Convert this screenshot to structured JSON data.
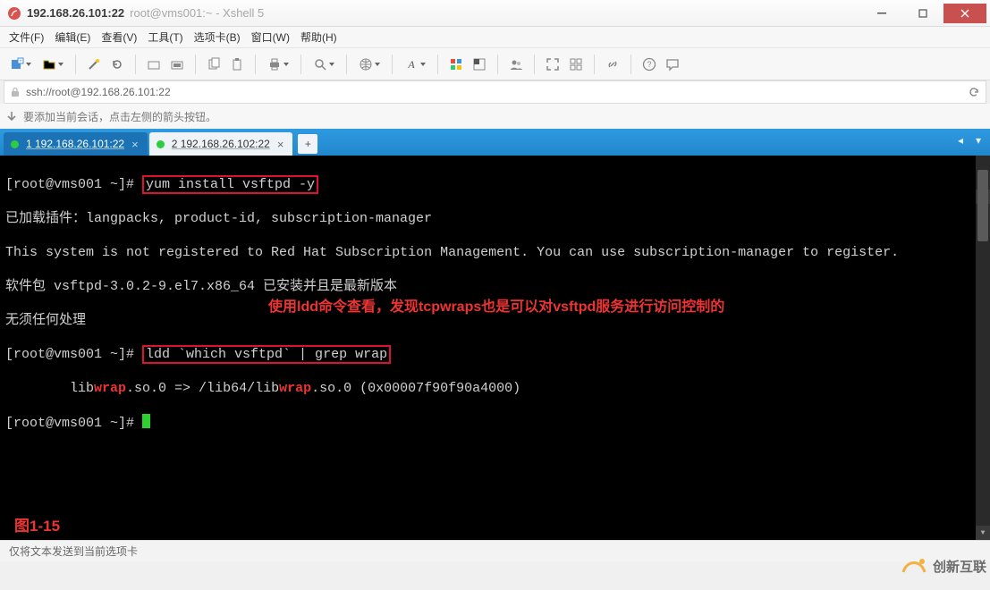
{
  "window": {
    "host_strong": "192.168.26.101:22",
    "title_suffix": "root@vms001:~ - Xshell 5",
    "min_icon": "minimize-icon",
    "max_icon": "maximize-icon",
    "close_icon": "close-icon"
  },
  "menu": {
    "items": [
      "文件(F)",
      "编辑(E)",
      "查看(V)",
      "工具(T)",
      "选项卡(B)",
      "窗口(W)",
      "帮助(H)"
    ]
  },
  "toolbar": {
    "items": [
      {
        "name": "new-session-icon",
        "dd": true
      },
      {
        "name": "open-icon",
        "dd": true
      },
      {
        "sep": true
      },
      {
        "name": "wand-icon"
      },
      {
        "name": "reconnect-icon"
      },
      {
        "sep": true
      },
      {
        "name": "folder-small-icon"
      },
      {
        "name": "folder-open-icon"
      },
      {
        "sep": true
      },
      {
        "name": "copy-icon"
      },
      {
        "name": "paste-icon"
      },
      {
        "sep": true
      },
      {
        "name": "print-icon",
        "dd": true
      },
      {
        "sep": true
      },
      {
        "name": "search-icon",
        "dd": true
      },
      {
        "sep": true
      },
      {
        "name": "globe-icon",
        "dd": true
      },
      {
        "sep": true
      },
      {
        "name": "font-icon",
        "dd": true
      },
      {
        "sep": true
      },
      {
        "name": "palette-icon"
      },
      {
        "name": "palette2-icon"
      },
      {
        "sep": true
      },
      {
        "name": "people-icon"
      },
      {
        "sep": true
      },
      {
        "name": "fullscreen-icon"
      },
      {
        "name": "tile-icon"
      },
      {
        "sep": true
      },
      {
        "name": "link-icon"
      },
      {
        "sep": true
      },
      {
        "name": "help-icon"
      },
      {
        "name": "chat-icon"
      }
    ]
  },
  "address": {
    "lock_icon": "lock-icon",
    "url": "ssh://root@192.168.26.101:22",
    "refresh_icon": "refresh-icon"
  },
  "hint": {
    "arrow_icon": "arrow-down-icon",
    "text": "要添加当前会话，点击左侧的箭头按钮。"
  },
  "tabs": {
    "items": [
      {
        "label": "1 192.168.26.101:22",
        "active": true
      },
      {
        "label": "2 192.168.26.102:22",
        "active": false
      }
    ],
    "add_label": "+",
    "prev_icon": "chevron-left-icon",
    "next_icon": "dropdown-icon"
  },
  "terminal": {
    "prompt": "[root@vms001 ~]# ",
    "cmd1": "yum install vsftpd -y",
    "line2": "已加载插件：langpacks, product-id, subscription-manager",
    "line3": "This system is not registered to Red Hat Subscription Management. You can use subscription-manager to register.",
    "line4": "软件包 vsftpd-3.0.2-9.el7.x86_64 已安装并且是最新版本",
    "line5": "无须任何处理",
    "cmd2": "ldd `which vsftpd` | grep wrap",
    "out2_pre": "        lib",
    "out2_wrap": "wrap",
    "out2_mid": ".so.0 => /lib64/lib",
    "out2_post": ".so.0 (0x00007f90f90a4000)",
    "annotation": "使用ldd命令查看，发现tcpwraps也是可以对vsftpd服务进行访问控制的",
    "fig_label": "图1-15"
  },
  "status": {
    "text": "仅将文本发送到当前选项卡"
  },
  "watermark": {
    "text": "创新互联"
  }
}
